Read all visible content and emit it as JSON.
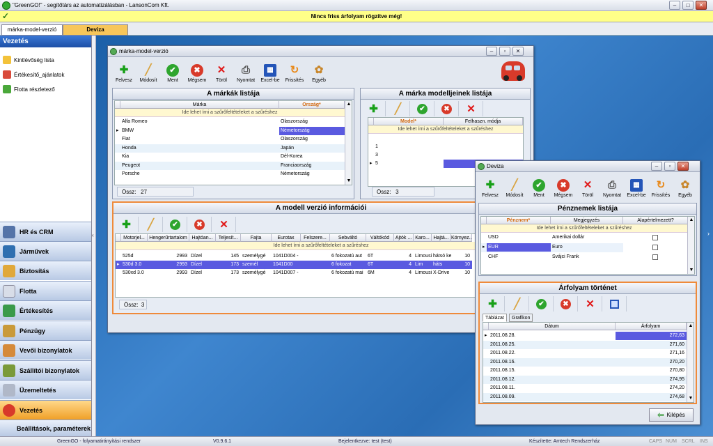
{
  "app": {
    "title": "\"GreenGO!\" - segítőtárs az automatizálásban - LansonCom Kft.",
    "notice": "Nincs friss árfolyam rögzítve még!"
  },
  "doc_tabs": [
    "márka-model-verzió",
    "Deviza"
  ],
  "nav": {
    "header": "Vezetés",
    "items": [
      "Kintlévőség lista",
      "Értékesítő_ajánlatok",
      "Flotta részletező"
    ],
    "groups": [
      "HR és CRM",
      "Járművek",
      "Biztosítás",
      "Flotta",
      "Értékesítés",
      "Pénzügy",
      "Vevői bizonylatok",
      "Szállítói bizonylatok",
      "Üzemeltetés",
      "Vezetés",
      "Beállítások, paraméterek"
    ],
    "active_group": "Vezetés"
  },
  "toolbar_labels": [
    "Felvesz",
    "Módosít",
    "Ment",
    "Mégsem",
    "Töröl",
    "Nyomtat",
    "Excel-be",
    "Frissítés",
    "Egyéb"
  ],
  "filter_hint": "Ide lehet írni a szűrőfeltételeket a szűréshez",
  "mmv": {
    "title": "márka-model-verzió",
    "brands": {
      "title": "A márkák listája",
      "columns": [
        "Márka",
        "Ország*"
      ],
      "rows": [
        [
          "Alfa Romeo",
          "Olaszország"
        ],
        [
          "BMW",
          "Németország"
        ],
        [
          "Fiat",
          "Olaszország"
        ],
        [
          "Honda",
          "Japán"
        ],
        [
          "Kia",
          "Dél-Korea"
        ],
        [
          "Peugeot",
          "Franciaország"
        ],
        [
          "Porsche",
          "Németország"
        ]
      ],
      "count_label": "Össz:",
      "count": "27"
    },
    "models": {
      "title": "A márka modelljeinek listája",
      "columns": [
        "Model*",
        "Felhaszn. módja"
      ],
      "rows": [
        "1",
        "3",
        "5"
      ],
      "count_label": "Össz:",
      "count": "3"
    },
    "versions": {
      "title": "A modell verzió információi",
      "columns": [
        "Motorjel...",
        "Hengerűrtartalom",
        "Hajtóan...",
        "Teljesít...",
        "Fajta",
        "Eurotax",
        "Felszere...",
        "Sebváltó",
        "Váltókód",
        "Ajtók ...",
        "Karo...",
        "Hajtá...",
        "Környez..."
      ],
      "rows": [
        [
          "525d",
          "2993",
          "Dízel",
          "145",
          "személygé",
          "1041D004 -",
          "",
          "6 fokozatú aut",
          "6T",
          "4",
          "Limousi",
          "hátsó ke",
          "10"
        ],
        [
          "530d 3.0",
          "2993",
          "Dízel",
          "173",
          "személ",
          "1041D00",
          "",
          "6 fokozat",
          "6T",
          "4",
          "Lim",
          "háts",
          "10"
        ],
        [
          "530xd 3.0",
          "2993",
          "Dízel",
          "173",
          "személygé",
          "1041D007 -",
          "",
          "6 fokozatú mai",
          "6M",
          "4",
          "Limousi",
          "X-Drive",
          "10"
        ]
      ],
      "count_label": "Össz:",
      "count": "3"
    }
  },
  "deviza": {
    "title": "Deviza",
    "currencies": {
      "title": "Pénznemek listája",
      "columns": [
        "Pénznem*",
        "Megjegyzés",
        "Alapértelmezett?"
      ],
      "rows": [
        [
          "USD",
          "Amerikai dollár"
        ],
        [
          "EUR",
          "Euro"
        ],
        [
          "CHF",
          "Svájci Frank"
        ]
      ]
    },
    "history": {
      "title": "Árfolyam történet",
      "tabs": [
        "Táblázat",
        "Grafikon"
      ],
      "columns": [
        "Dátum",
        "Árfolyam"
      ],
      "rows": [
        [
          "2011.08.28.",
          "272,63"
        ],
        [
          "2011.08.25.",
          "271,60"
        ],
        [
          "2011.08.22.",
          "271,16"
        ],
        [
          "2011.08.16.",
          "270,20"
        ],
        [
          "2011.08.15.",
          "270,80"
        ],
        [
          "2011.08.12.",
          "274,95"
        ],
        [
          "2011.08.11.",
          "274,20"
        ],
        [
          "2011.08.09.",
          "274,68"
        ]
      ]
    },
    "exit_label": "Kilépés"
  },
  "status": {
    "left": "GreenGO - folyamatirányítási rendszer",
    "version": "V0.9.6.1",
    "login": "Bejelentkezve: test (test)",
    "maker": "Készítette: Amtech Rendszerház",
    "keys": [
      "CAPS",
      "NUM",
      "SCRL",
      "INS"
    ]
  }
}
